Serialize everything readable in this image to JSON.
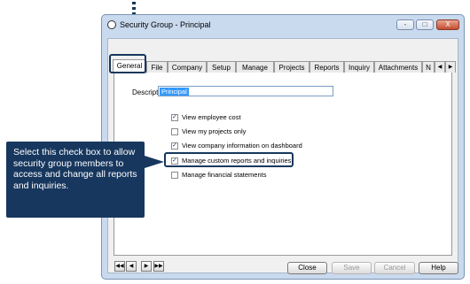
{
  "window": {
    "title": "Security Group - Principal",
    "icon": "app-icon",
    "controls": {
      "minimize": "-",
      "maximize": "□",
      "close": "X"
    }
  },
  "tabs": [
    "General",
    "File",
    "Company",
    "Setup",
    "Manage",
    "Projects",
    "Reports",
    "Inquiry",
    "Attachments",
    "N"
  ],
  "active_tab": "General",
  "description": {
    "label": "Description",
    "value": "Principal"
  },
  "options": [
    {
      "label": "View employee cost",
      "checked": true
    },
    {
      "label": "View my projects only",
      "checked": false
    },
    {
      "label": "View company information on dashboard",
      "checked": true
    },
    {
      "label": "Manage custom reports and inquiries",
      "checked": true
    },
    {
      "label": "Manage financial statements",
      "checked": false
    }
  ],
  "nav_buttons": [
    "first",
    "previous",
    "next",
    "last"
  ],
  "buttons": {
    "close": "Close",
    "save": "Save",
    "cancel": "Cancel",
    "help": "Help"
  },
  "callout": {
    "text": "Select this check box to allow security group members to access and change all reports and inquiries."
  },
  "colors": {
    "callout": "#17375e",
    "window": "#c9d9ee",
    "selection": "#3399ff"
  }
}
